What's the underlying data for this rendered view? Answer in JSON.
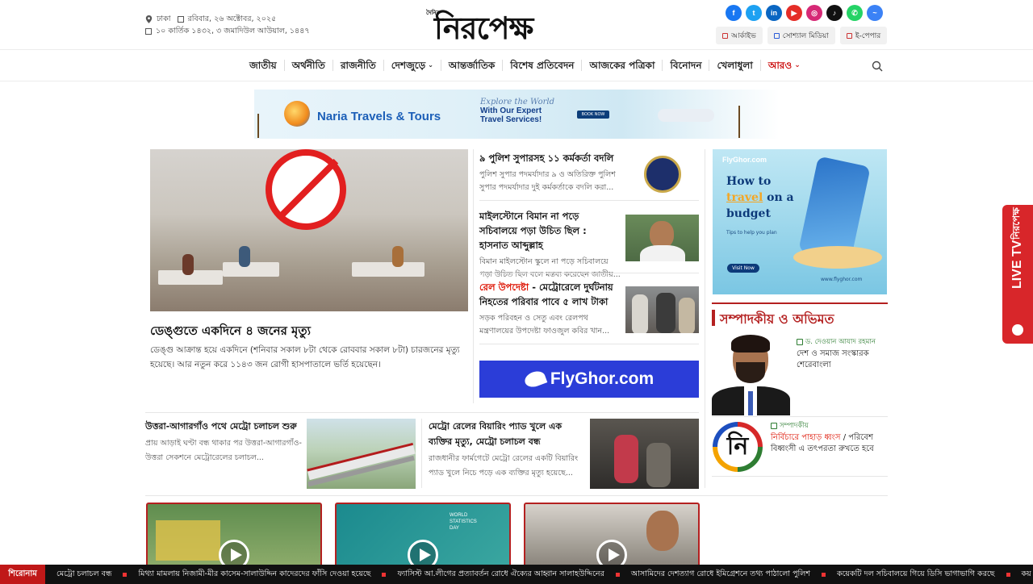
{
  "header": {
    "location": "ঢাকা",
    "date_en": "রবিবার, ২৬ অক্টোবর, ২০২৫",
    "date_bn": "১০ কার্তিক ১৪৩২, ৩ জমাদিউল আউয়াল, ১৪৪৭",
    "logo_small": "দৈনিক",
    "logo": "নিরপেক্ষ",
    "social": [
      {
        "name": "facebook",
        "glyph": "f",
        "color": "#1877f2"
      },
      {
        "name": "twitter",
        "glyph": "t",
        "color": "#1da1f2"
      },
      {
        "name": "linkedin",
        "glyph": "in",
        "color": "#0a66c2"
      },
      {
        "name": "youtube",
        "glyph": "▶",
        "color": "#e52d27"
      },
      {
        "name": "instagram",
        "glyph": "◎",
        "color": "#d62976"
      },
      {
        "name": "tiktok",
        "glyph": "♪",
        "color": "#111111"
      },
      {
        "name": "whatsapp",
        "glyph": "✆",
        "color": "#25d366"
      },
      {
        "name": "messenger",
        "glyph": "~",
        "color": "#3b82f6"
      }
    ],
    "quick": [
      "আর্কাইভ",
      "সোশ্যাল মিডিয়া",
      "ই-পেপার"
    ]
  },
  "nav": [
    "জাতীয়",
    "অর্থনীতি",
    "রাজনীতি",
    "দেশজুড়ে",
    "আন্তর্জাতিক",
    "বিশেষ প্রতিবেদন",
    "আজকের পত্রিকা",
    "বিনোদন",
    "খেলাধুলা",
    "আরও"
  ],
  "ad_top": {
    "brand": "Naria Travels & Tours",
    "tag1": "Explore the World",
    "tag2": "With Our Expert",
    "tag3": "Travel Services!",
    "book": "BOOK NOW"
  },
  "lead": {
    "title": "ডেঙ্গুতে একদিনে ৪ জনের মৃত্যু",
    "text": "ডেঙ্গু আক্রান্ত হয়ে একদিনে (শনিবার সকাল ৮টা থেকে রোববার সকাল ৮টা) চারজনের মৃত্যু হয়েছে। আর নতুন করে ১১৪৩ জন রোগী হাসপাতালে ভর্তি হয়েছেন।"
  },
  "mid": [
    {
      "title": "৯ পুলিশ সুপারসহ ১১ কর্মকর্তা বদলি",
      "red": "",
      "desc": "পুলিশ সুপার পদমর্যাদার ৯ ও অতিরিক্ত পুলিশ সুপার পদমর্যাদার দুই কর্মকর্তাকে বদলি করা..."
    },
    {
      "title": "মাইলস্টোনে বিমান না পড়ে সচিবালয়ে পড়া উচিত ছিল : হাসনাত আব্দুল্লাহ",
      "red": "",
      "desc": "বিমান মাইলস্টোন স্কুলে না পড়ে সচিবালয়ে পড়া উচিত ছিল বলে মন্তব্য করেছেন জাতীয়..."
    },
    {
      "title": " - মেট্রোরেলে দুর্ঘটনায় নিহতের পরিবার পাবে ৫ লাখ টাকা",
      "red": "রেল উপদেষ্টা",
      "desc": "সড়ক পরিবহন ও সেতু এবং রেলপথ মন্ত্রণালয়ের উপদেষ্টা ফাওজুল কবির খান..."
    }
  ],
  "ad_mid": {
    "brand": "FlyGhor.com"
  },
  "ad_right": {
    "logo": "FlyGhor.com",
    "h1": "How to",
    "h2": "travel",
    "h3": " on a",
    "h4": "budget",
    "sub": "Tips to help you plan",
    "btn": "Visit Now",
    "url": "www.flyghor.com"
  },
  "editorial": {
    "heading": "সম্পাদকীয় ও অভিমত",
    "items": [
      {
        "author": "ড. দেওয়ান আযাদ রহমান",
        "title": "দেশ ও সমাজ সংস্কারক শেরেবাংলা",
        "red": ""
      },
      {
        "author": "সম্পাদকীয়",
        "red": "নির্বিচারে পাহাড় ধ্বংস",
        "title": " / পরিবেশ বিধ্বংসী এ তৎপরতা রুখতে হবে"
      }
    ]
  },
  "row2": [
    {
      "title": "উত্তরা-আগারগাঁও পথে মেট্রো চলাচল শুরু",
      "desc": "প্রায় আড়াই ঘণ্টা বন্ধ থাকার পর উত্তরা-আগারগাঁও-উত্তরা সেকশনে মেট্রোরেলের চলাচল..."
    },
    {
      "title": "মেট্রো রেলের বিয়ারিং প্যাড খুলে এক ব্যক্তির মৃত্যু, মেট্রো চলাচল বন্ধ",
      "desc": "রাজধানীর ফার্মগেটে মেট্রো রেলের একটি বিয়ারিং প্যাড খুলে নিচে পড়ে এক ব্যক্তির মৃত্যু হয়েছে..."
    }
  ],
  "live": {
    "label": "LIVE TV",
    "brand": "নিরপেক্ষ"
  },
  "ticker": {
    "label": "শিরোনাম",
    "items": [
      "মেট্রো চলাচল বন্ধ",
      "মিথ্যা মামলায় নিজামী-মীর কাসেম-সালাউদ্দিন কাদেরদের ফাঁসি দেওয়া হয়েছে",
      "ফ্যাসিস্ট আ.লীগের প্রত্যাবর্তন রোধে ঐক্যের আহ্বান সালাহউদ্দিনের",
      "আসামিদের দেশত্যাগ রোধে ইমিগ্রেশনে তথ্য পাঠালো পুলিশ",
      "কয়েকটি দল সচিবালয়ে গিয়ে ডিসি ভাগাভাগি করছে",
      "কয়"
    ]
  }
}
